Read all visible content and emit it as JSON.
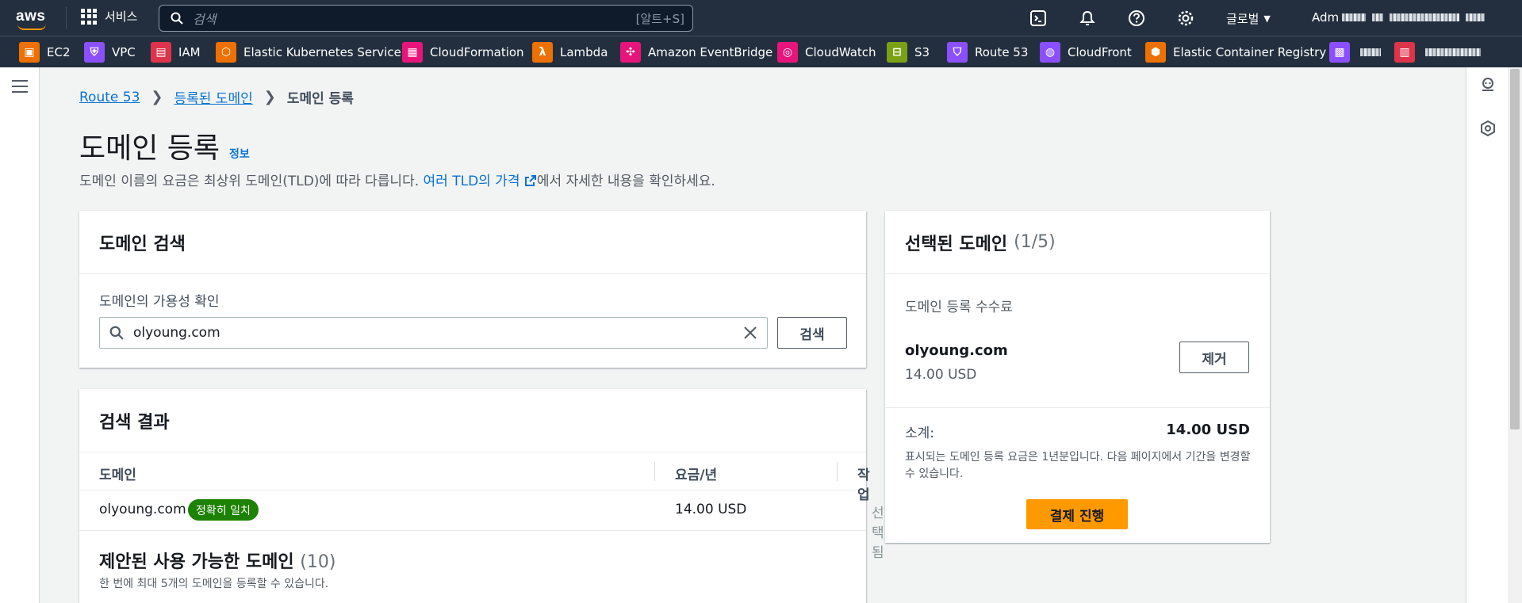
{
  "topnav": {
    "logo": "aws",
    "services_label": "서비스",
    "search_placeholder": "검색",
    "search_hint": "[알트+S]",
    "region_label": "글로벌",
    "account_prefix": "Adm"
  },
  "favorites": [
    {
      "label": "EC2",
      "icon": "ec2-icon",
      "color": "#ed7100"
    },
    {
      "label": "VPC",
      "icon": "vpc-icon",
      "color": "#8c4fff"
    },
    {
      "label": "IAM",
      "icon": "iam-icon",
      "color": "#dd344c"
    },
    {
      "label": "Elastic Kubernetes Service",
      "icon": "eks-icon",
      "color": "#ed7100"
    },
    {
      "label": "CloudFormation",
      "icon": "cloudformation-icon",
      "color": "#e7157b"
    },
    {
      "label": "Lambda",
      "icon": "lambda-icon",
      "color": "#ed7100"
    },
    {
      "label": "Amazon EventBridge",
      "icon": "eventbridge-icon",
      "color": "#e7157b"
    },
    {
      "label": "CloudWatch",
      "icon": "cloudwatch-icon",
      "color": "#e7157b"
    },
    {
      "label": "S3",
      "icon": "s3-icon",
      "color": "#7aa116"
    },
    {
      "label": "Route 53",
      "icon": "route53-icon",
      "color": "#8c4fff"
    },
    {
      "label": "CloudFront",
      "icon": "cloudfront-icon",
      "color": "#8c4fff"
    },
    {
      "label": "Elastic Container Registry",
      "icon": "ecr-icon",
      "color": "#ed7100"
    }
  ],
  "breadcrumb": {
    "items": [
      "Route 53",
      "등록된 도메인"
    ],
    "current": "도메인 등록"
  },
  "page": {
    "title": "도메인 등록",
    "info_link": "정보",
    "desc_before": "도메인 이름의 요금은 최상위 도메인(TLD)에 따라 다릅니다. ",
    "desc_link": "여러 TLD의 가격",
    "desc_after": "에서 자세한 내용을 확인하세요."
  },
  "search_panel": {
    "title": "도메인 검색",
    "field_label": "도메인의 가용성 확인",
    "input_value": "olyoung.com",
    "search_button": "검색"
  },
  "results_panel": {
    "title": "검색 결과",
    "columns": [
      "도메인",
      "요금/년",
      "작업"
    ],
    "row": {
      "domain": "olyoung.com",
      "badge": "정확히 일치",
      "price": "14.00 USD",
      "action": "선택됨"
    },
    "suggested_title": "제안된 사용 가능한 도메인",
    "suggested_count": "(10)",
    "suggested_note": "한 번에 최대 5개의 도메인을 등록할 수 있습니다."
  },
  "selected_panel": {
    "title": "선택된 도메인",
    "count": "(1/5)",
    "fee_label": "도메인 등록 수수료",
    "domain": "olyoung.com",
    "price": "14.00 USD",
    "remove_button": "제거",
    "subtotal_label": "소계:",
    "subtotal_value": "14.00 USD",
    "note": "표시되는 도메인 등록 요금은 1년분입니다. 다음 페이지에서 기간을 변경할 수 있습니다.",
    "checkout_button": "결제 진행"
  }
}
